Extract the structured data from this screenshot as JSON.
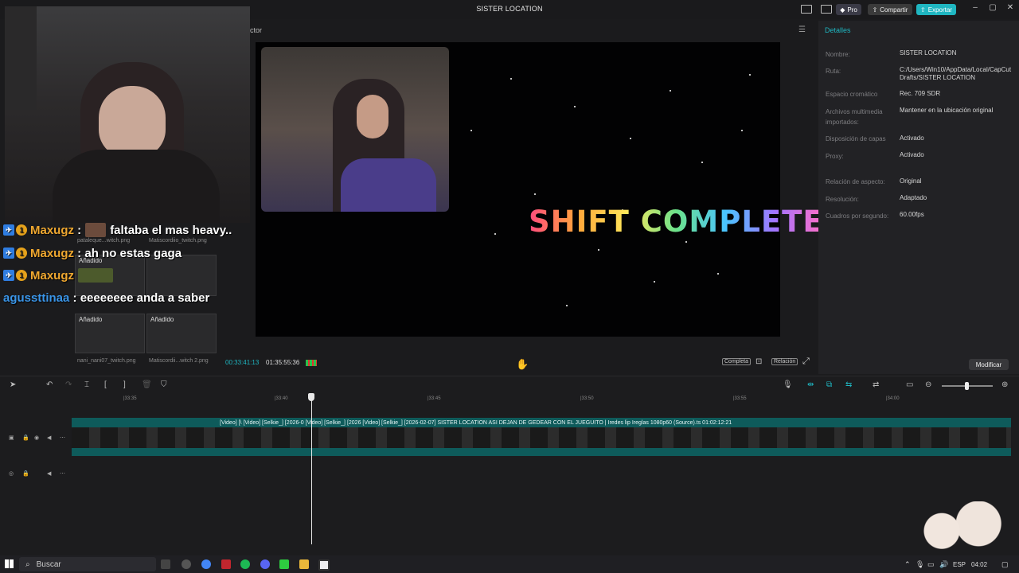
{
  "window": {
    "title": "SISTER LOCATION",
    "pro_label": "Pro",
    "share_label": "Compartir",
    "export_label": "Exportar"
  },
  "chat": [
    {
      "user": "Maxugz",
      "message": "faltaba el mas heavy.."
    },
    {
      "user": "Maxugz",
      "message": "ah no estas gaga"
    },
    {
      "user": "Maxugz",
      "message": ""
    },
    {
      "user": "agussttinaa",
      "message": "eeeeeeee anda a saber"
    }
  ],
  "media": {
    "items": [
      {
        "badge": "",
        "label": "pataleque...witch.png"
      },
      {
        "badge": "",
        "label": "Matiscordiio_twitch.png"
      },
      {
        "badge": "Añadido",
        "label": ""
      },
      {
        "badge": "",
        "label": ""
      },
      {
        "badge": "Añadido",
        "label": "nani_nani07_twitch.png"
      },
      {
        "badge": "Añadido",
        "label": "Matiscordii...witch 2.png"
      }
    ]
  },
  "player": {
    "panel_label": "ctor",
    "overlay_text": "SHIFT COMPLETE",
    "time_current": "00:33:41:13",
    "time_total": "01:35:55:36",
    "full_label": "Completa",
    "ratio_label": "Relación"
  },
  "details": {
    "title": "Detalles",
    "fields": [
      {
        "label": "Nombre:",
        "value": "SISTER LOCATION"
      },
      {
        "label": "Ruta:",
        "value": "C:/Users/Win10/AppData/Local/CapCut Drafts/SISTER LOCATION"
      },
      {
        "label": "Espacio cromático",
        "value": "Rec. 709 SDR"
      },
      {
        "label": "Archivos multimedia importados:",
        "value": "Mantener en la ubicación original"
      },
      {
        "label": "Disposición de capas",
        "value": "Activado"
      },
      {
        "label": "Proxy:",
        "value": "Activado"
      },
      {
        "label": "Relación de aspecto:",
        "value": "Original"
      },
      {
        "label": "Resolución:",
        "value": "Adaptado"
      },
      {
        "label": "Cuadros por segundo:",
        "value": "60.00fps"
      }
    ],
    "modify_label": "Modificar"
  },
  "timeline": {
    "ruler": [
      "|33:35",
      "|33:40",
      "|33:45",
      "|33:50",
      "|33:55",
      "|34:00"
    ],
    "clip_label": "[Video]   [\\  [Video] [Selkie_] [2026-0   [Video] [Selkie_] [2026   [Video] [Selkie_] [2026-02-07] SISTER LOCATION ASI DEJAN DE GEDEAR CON EL JUEGUITO  |  Iredes lip Ireglas 1080p60 (Source).ts  01:02:12:21"
  },
  "taskbar": {
    "search_placeholder": "Buscar",
    "language": "ESP",
    "time": "04:02"
  },
  "colors": {
    "accent": "#1fb6c1",
    "chat_user": "#f0a830",
    "chat_user_alt": "#3a95e8"
  }
}
